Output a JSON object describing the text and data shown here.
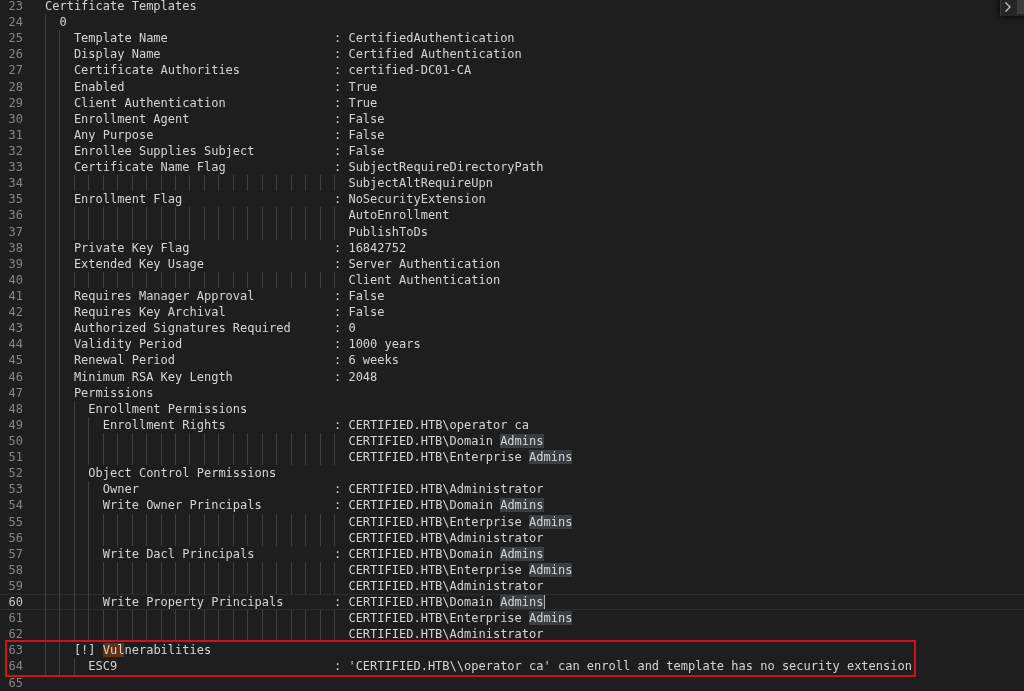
{
  "find_widget": {
    "expanded": false
  },
  "lines": [
    {
      "n": "23",
      "key": "Certificate Templates"
    },
    {
      "n": "24",
      "key": "  0"
    },
    {
      "n": "25",
      "key": "    Template Name",
      "value": ": CertifiedAuthentication"
    },
    {
      "n": "26",
      "key": "    Display Name",
      "value": ": Certified Authentication"
    },
    {
      "n": "27",
      "key": "    Certificate Authorities",
      "value": ": certified-DC01-CA"
    },
    {
      "n": "28",
      "key": "    Enabled",
      "value": ": True"
    },
    {
      "n": "29",
      "key": "    Client Authentication",
      "value": ": True"
    },
    {
      "n": "30",
      "key": "    Enrollment Agent",
      "value": ": False"
    },
    {
      "n": "31",
      "key": "    Any Purpose",
      "value": ": False"
    },
    {
      "n": "32",
      "key": "    Enrollee Supplies Subject",
      "value": ": False"
    },
    {
      "n": "33",
      "key": "    Certificate Name Flag",
      "value": ": SubjectRequireDirectoryPath"
    },
    {
      "n": "34",
      "value": "SubjectAltRequireUpn"
    },
    {
      "n": "35",
      "key": "    Enrollment Flag",
      "value": ": NoSecurityExtension"
    },
    {
      "n": "36",
      "value": "AutoEnrollment"
    },
    {
      "n": "37",
      "value": "PublishToDs"
    },
    {
      "n": "38",
      "key": "    Private Key Flag",
      "value": ": 16842752"
    },
    {
      "n": "39",
      "key": "    Extended Key Usage",
      "value": ": Server Authentication"
    },
    {
      "n": "40",
      "value": "Client Authentication"
    },
    {
      "n": "41",
      "key": "    Requires Manager Approval",
      "value": ": False"
    },
    {
      "n": "42",
      "key": "    Requires Key Archival",
      "value": ": False"
    },
    {
      "n": "43",
      "key": "    Authorized Signatures Required",
      "value": ": 0"
    },
    {
      "n": "44",
      "key": "    Validity Period",
      "value": ": 1000 years"
    },
    {
      "n": "45",
      "key": "    Renewal Period",
      "value": ": 6 weeks"
    },
    {
      "n": "46",
      "key": "    Minimum RSA Key Length",
      "value": ": 2048"
    },
    {
      "n": "47",
      "key": "    Permissions"
    },
    {
      "n": "48",
      "key": "      Enrollment Permissions"
    },
    {
      "n": "49",
      "key": "        Enrollment Rights",
      "value": ": CERTIFIED.HTB\\operator ca"
    },
    {
      "n": "50",
      "value": [
        {
          "text": "CERTIFIED.HTB\\Domain "
        },
        {
          "text": "Admins",
          "highlighted": true,
          "kind": "word"
        }
      ]
    },
    {
      "n": "51",
      "value": [
        {
          "text": "CERTIFIED.HTB\\Enterprise "
        },
        {
          "text": "Admins",
          "highlighted": true,
          "kind": "word"
        }
      ]
    },
    {
      "n": "52",
      "key": "      Object Control Permissions"
    },
    {
      "n": "53",
      "key": "        Owner",
      "value": ": CERTIFIED.HTB\\Administrator"
    },
    {
      "n": "54",
      "key": "        Write Owner Principals",
      "value": [
        {
          "text": ": CERTIFIED.HTB\\Domain "
        },
        {
          "text": "Admins",
          "highlighted": true,
          "kind": "word"
        }
      ]
    },
    {
      "n": "55",
      "value": [
        {
          "text": "CERTIFIED.HTB\\Enterprise "
        },
        {
          "text": "Admins",
          "highlighted": true,
          "kind": "word"
        }
      ]
    },
    {
      "n": "56",
      "value": "CERTIFIED.HTB\\Administrator"
    },
    {
      "n": "57",
      "key": "        Write Dacl Principals",
      "value": [
        {
          "text": ": CERTIFIED.HTB\\Domain "
        },
        {
          "text": "Admins",
          "highlighted": true,
          "kind": "word"
        }
      ]
    },
    {
      "n": "58",
      "value": [
        {
          "text": "CERTIFIED.HTB\\Enterprise "
        },
        {
          "text": "Admins",
          "highlighted": true,
          "kind": "word"
        }
      ]
    },
    {
      "n": "59",
      "value": "CERTIFIED.HTB\\Administrator"
    },
    {
      "n": "60",
      "current": true,
      "key": "        Write Property Principals",
      "value": [
        {
          "text": ": CERTIFIED.HTB\\Domain "
        },
        {
          "text": "Admins",
          "highlighted": true,
          "kind": "word"
        }
      ]
    },
    {
      "n": "61",
      "value": [
        {
          "text": "CERTIFIED.HTB\\Enterprise "
        },
        {
          "text": "Admins",
          "highlighted": true,
          "kind": "word"
        }
      ]
    },
    {
      "n": "62",
      "value": "CERTIFIED.HTB\\Administrator"
    },
    {
      "n": "63",
      "boxed": true,
      "key": [
        {
          "text": "    [!] "
        },
        {
          "text": "Vul",
          "highlighted": true,
          "kind": "search"
        },
        {
          "text": "nerabilities"
        }
      ]
    },
    {
      "n": "64",
      "boxed": true,
      "key": "      ESC9",
      "value": ": 'CERTIFIED.HTB\\\\operator ca' can enroll and template has no security extension"
    },
    {
      "n": "65"
    }
  ]
}
